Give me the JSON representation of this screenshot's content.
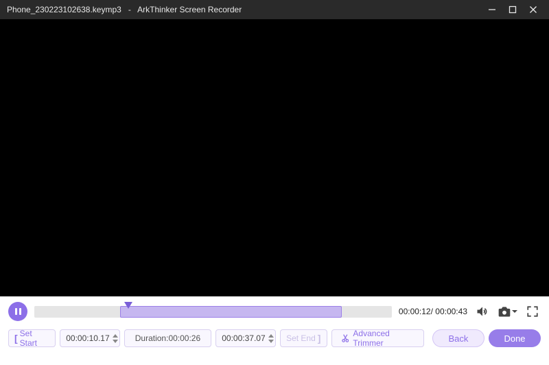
{
  "titlebar": {
    "filename": "Phone_230223102638.keymp3",
    "app_name": "ArkThinker Screen Recorder"
  },
  "playback": {
    "current_time": "00:00:12",
    "total_time": "00:00:43",
    "range_start_pct": 24,
    "range_end_pct": 86,
    "playhead_pct": 26.3
  },
  "trim": {
    "set_start_label": "Set Start",
    "set_end_label": "Set End",
    "start_time": "00:00:10.17",
    "end_time": "00:00:37.07",
    "duration_label": "Duration:",
    "duration_value": "00:00:26",
    "advanced_label": "Advanced Trimmer"
  },
  "buttons": {
    "back": "Back",
    "done": "Done"
  }
}
